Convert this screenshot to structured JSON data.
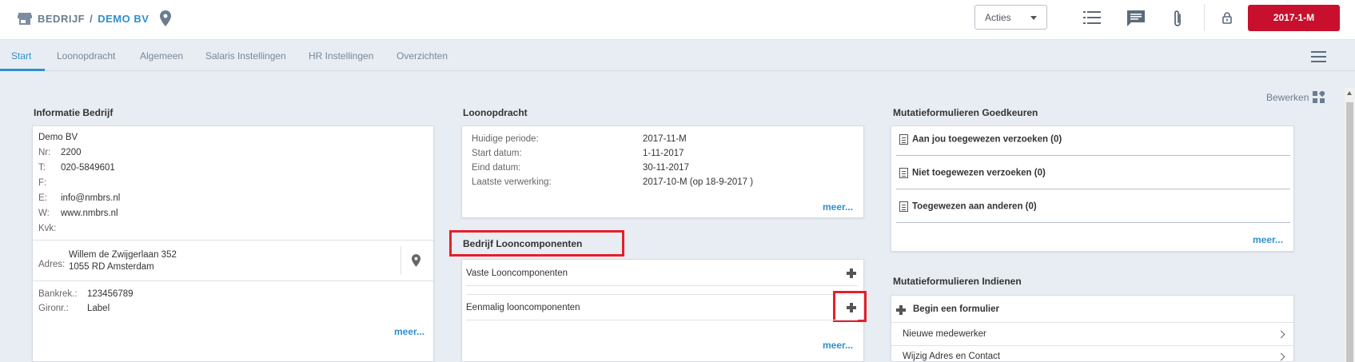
{
  "header": {
    "breadcrumb_root": "BEDRIJF",
    "breadcrumb_sep": "/",
    "company": "DEMO BV",
    "acties_label": "Acties",
    "period_button": "2017-1-M",
    "icons": [
      "store-icon",
      "location-pin-icon",
      "list-icon",
      "chat-icon",
      "paperclip-icon",
      "lock-icon"
    ]
  },
  "tabs": [
    {
      "label": "Start",
      "active": true
    },
    {
      "label": "Loonopdracht"
    },
    {
      "label": "Algemeen"
    },
    {
      "label": "Salaris Instellingen"
    },
    {
      "label": "HR Instellingen"
    },
    {
      "label": "Overzichten"
    }
  ],
  "edit_label": "Bewerken",
  "bedrijf": {
    "title": "Informatie Bedrijf",
    "name": "Demo BV",
    "rows": [
      {
        "label": "Nr:",
        "value": "2200"
      },
      {
        "label": "T:",
        "value": "020-5849601"
      },
      {
        "label": "F:",
        "value": ""
      },
      {
        "label": "E:",
        "value": "info@nmbrs.nl"
      },
      {
        "label": "W:",
        "value": "www.nmbrs.nl"
      },
      {
        "label": "Kvk:",
        "value": ""
      }
    ],
    "adres_label": "Adres:",
    "adres_line1": "Willem de Zwijgerlaan 352",
    "adres_line2": "1055 RD Amsterdam",
    "bank_label": "Bankrek.:",
    "bank_value": "123456789",
    "giro_label": "Gironr.:",
    "giro_value": "Label",
    "meer": "meer..."
  },
  "loonopdracht": {
    "title": "Loonopdracht",
    "rows": [
      {
        "label": "Huidige periode:",
        "value": "2017-11-M"
      },
      {
        "label": "Start datum:",
        "value": "1-11-2017"
      },
      {
        "label": "Eind datum:",
        "value": "30-11-2017"
      },
      {
        "label": "Laatste verwerking:",
        "value": "2017-10-M (op 18-9-2017 )"
      }
    ],
    "meer": "meer..."
  },
  "looncomponenten": {
    "title": "Bedrijf Looncomponenten",
    "vaste": "Vaste Looncomponenten",
    "eenmalig": "Eenmalig looncomponenten",
    "meer": "meer..."
  },
  "goedkeuren": {
    "title": "Mutatieformulieren Goedkeuren",
    "items": [
      "Aan jou toegewezen verzoeken (0)",
      "Niet toegewezen verzoeken (0)",
      "Toegewezen aan anderen (0)"
    ],
    "meer": "meer..."
  },
  "indienen": {
    "title": "Mutatieformulieren Indienen",
    "begin": "Begin een formulier",
    "items": [
      "Nieuwe medewerker",
      "Wijzig Adres en Contact"
    ]
  },
  "colors": {
    "accent": "#2f8fd0",
    "brand_red": "#c8102e",
    "highlight": "#e3202b"
  }
}
